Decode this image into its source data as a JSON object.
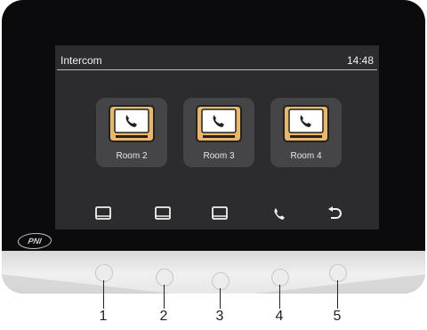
{
  "screen": {
    "title": "Intercom",
    "time": "14:48"
  },
  "rooms": [
    {
      "label": "Room 2",
      "icon": "monitor-phone-icon"
    },
    {
      "label": "Room 3",
      "icon": "monitor-phone-icon"
    },
    {
      "label": "Room 4",
      "icon": "monitor-phone-icon"
    }
  ],
  "softkeys": [
    {
      "icon": "monitor-icon"
    },
    {
      "icon": "monitor-icon"
    },
    {
      "icon": "monitor-icon"
    },
    {
      "icon": "phone-icon"
    },
    {
      "icon": "back-arrow-icon"
    }
  ],
  "brand": "PNI",
  "hardware_buttons": [
    {
      "label": "1"
    },
    {
      "label": "2"
    },
    {
      "label": "3"
    },
    {
      "label": "4"
    },
    {
      "label": "5"
    }
  ],
  "colors": {
    "accent": "#e8b76a",
    "screen_bg": "#2c2c2e",
    "tile_bg": "#454548"
  }
}
